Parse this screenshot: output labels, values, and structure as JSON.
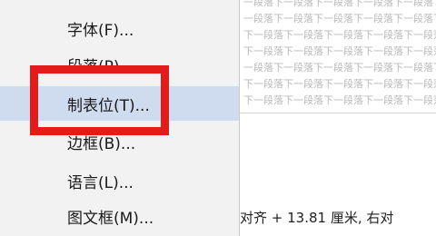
{
  "document": {
    "body_lines": [
      "一段落下一段落下一段落下一段落下一段落下一段",
      "一段落下一段落下一段落下一段落下一段落下一段",
      "下一段落下一段落下一段落下一段落下一段落下一",
      "下一段落下一段落下一段落下一段落下一段落下一",
      "一段落下一段落下一段落下一段落下一段落下一段",
      "下一段落下一段落下一段落下一段落下一段落下一",
      "下一段落下一段落下一段落下一段落下一段落下一"
    ],
    "status_text": "对齐 +  13.81 厘米, 右对"
  },
  "context_menu": {
    "items": [
      {
        "label": "字体(F)..."
      },
      {
        "label": "段落(P)..."
      },
      {
        "label": "制表位(T)..."
      },
      {
        "label": "边框(B)..."
      },
      {
        "label": "语言(L)..."
      },
      {
        "label": "图文框(M)..."
      }
    ]
  },
  "colors": {
    "menu_background": "#f2f2f2",
    "highlight": "#cfdcf0",
    "annotation_red": "#e21b1b"
  }
}
